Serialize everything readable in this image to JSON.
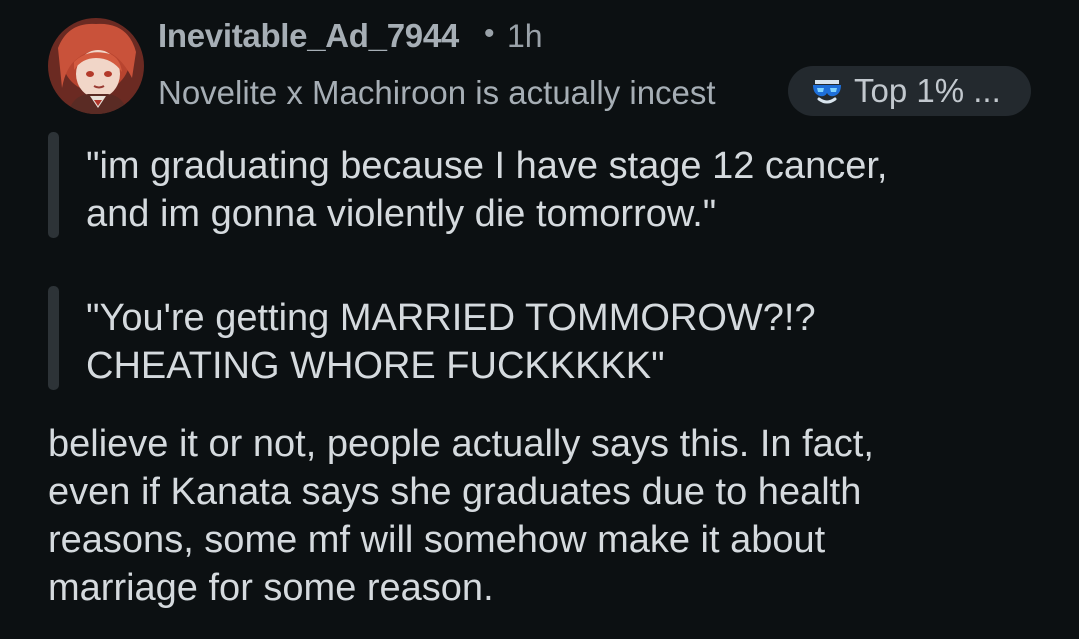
{
  "comment": {
    "author": "Inevitable_Ad_7944",
    "separator": "•",
    "time": "1h",
    "flair": "Novelite x Machiroon is actually incest",
    "badge": {
      "icon": "commenter-badge-icon",
      "label": "Top 1% ..."
    },
    "quotes": [
      {
        "text": "\"im graduating because I have stage 12 cancer,\nand im gonna violently die tomorrow.\""
      },
      {
        "text": "\"You're getting MARRIED TOMMOROW?!?\nCHEATING WHORE FUCKKKKK\""
      }
    ],
    "body": "believe it or not, people actually says this. In fact,\neven if Kanata says she graduates due to health\nreasons, some mf will somehow make it about\nmarriage for some reason.",
    "colors": {
      "background": "#0c1012",
      "username": "#a6aeb5",
      "text": "#d5dade",
      "quote_bar": "#2d3337",
      "badge_bg": "#23292e"
    }
  }
}
